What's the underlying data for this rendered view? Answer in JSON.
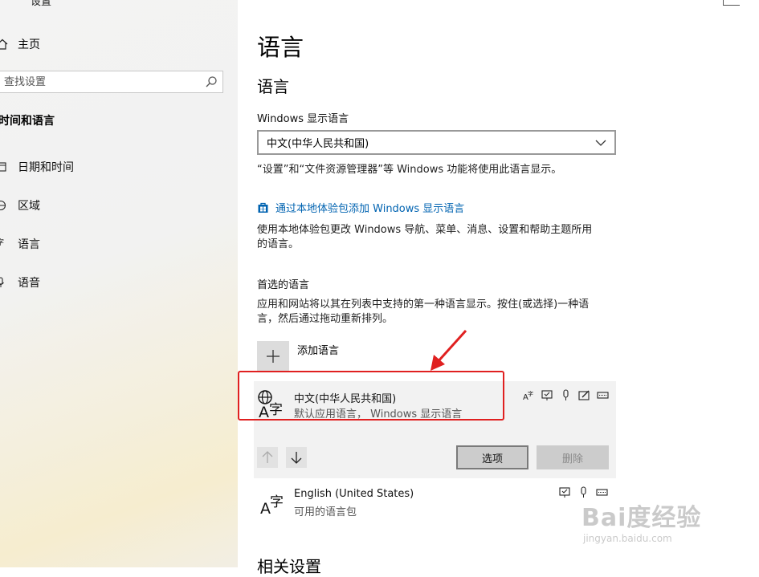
{
  "sidebar": {
    "title": "设置",
    "home": "主页",
    "search_placeholder": "查找设置",
    "section": "时间和语言",
    "items": [
      {
        "label": "日期和时间",
        "icon": "calendar-clock-icon"
      },
      {
        "label": "区域",
        "icon": "globe-icon"
      },
      {
        "label": "语言",
        "icon": "language-icon"
      },
      {
        "label": "语音",
        "icon": "microphone-icon"
      }
    ]
  },
  "main": {
    "title": "语言",
    "subtitle": "语言",
    "display_language_label": "Windows 显示语言",
    "display_language_value": "中文(中华人民共和国)",
    "display_language_note": "“设置”和“文件资源管理器”等 Windows 功能将使用此语言显示。",
    "store_link": "通过本地体验包添加 Windows 显示语言",
    "store_desc_1": "使用本地体验包更改 Windows 导航、菜单、消息、设置和帮助主题所用",
    "store_desc_2": "的语言。",
    "preferred_label": "首选的语言",
    "preferred_desc_1": "应用和网站将以其在列表中支持的第一种语言显示。按住(或选择)一种语",
    "preferred_desc_2": "言，然后通过拖动重新排列。",
    "add_language": "添加语言",
    "languages": [
      {
        "name": "中文(中华人民共和国)",
        "detail": "默认应用语言，  Windows 显示语言",
        "glyph_top": "⊕",
        "glyph_bottom": "A字"
      },
      {
        "name": "English (United States)",
        "detail": "可用的语言包",
        "glyph_top": "",
        "glyph_bottom": "A字"
      }
    ],
    "options_button": "选项",
    "remove_button": "删除",
    "related_settings": "相关设置"
  },
  "watermark": {
    "text": "Bai度经验",
    "sub": "jingyan.baidu.com"
  },
  "colors": {
    "link": "#0063b1",
    "highlight_box": "#e02020",
    "annotation_arrow": "#e02020"
  }
}
